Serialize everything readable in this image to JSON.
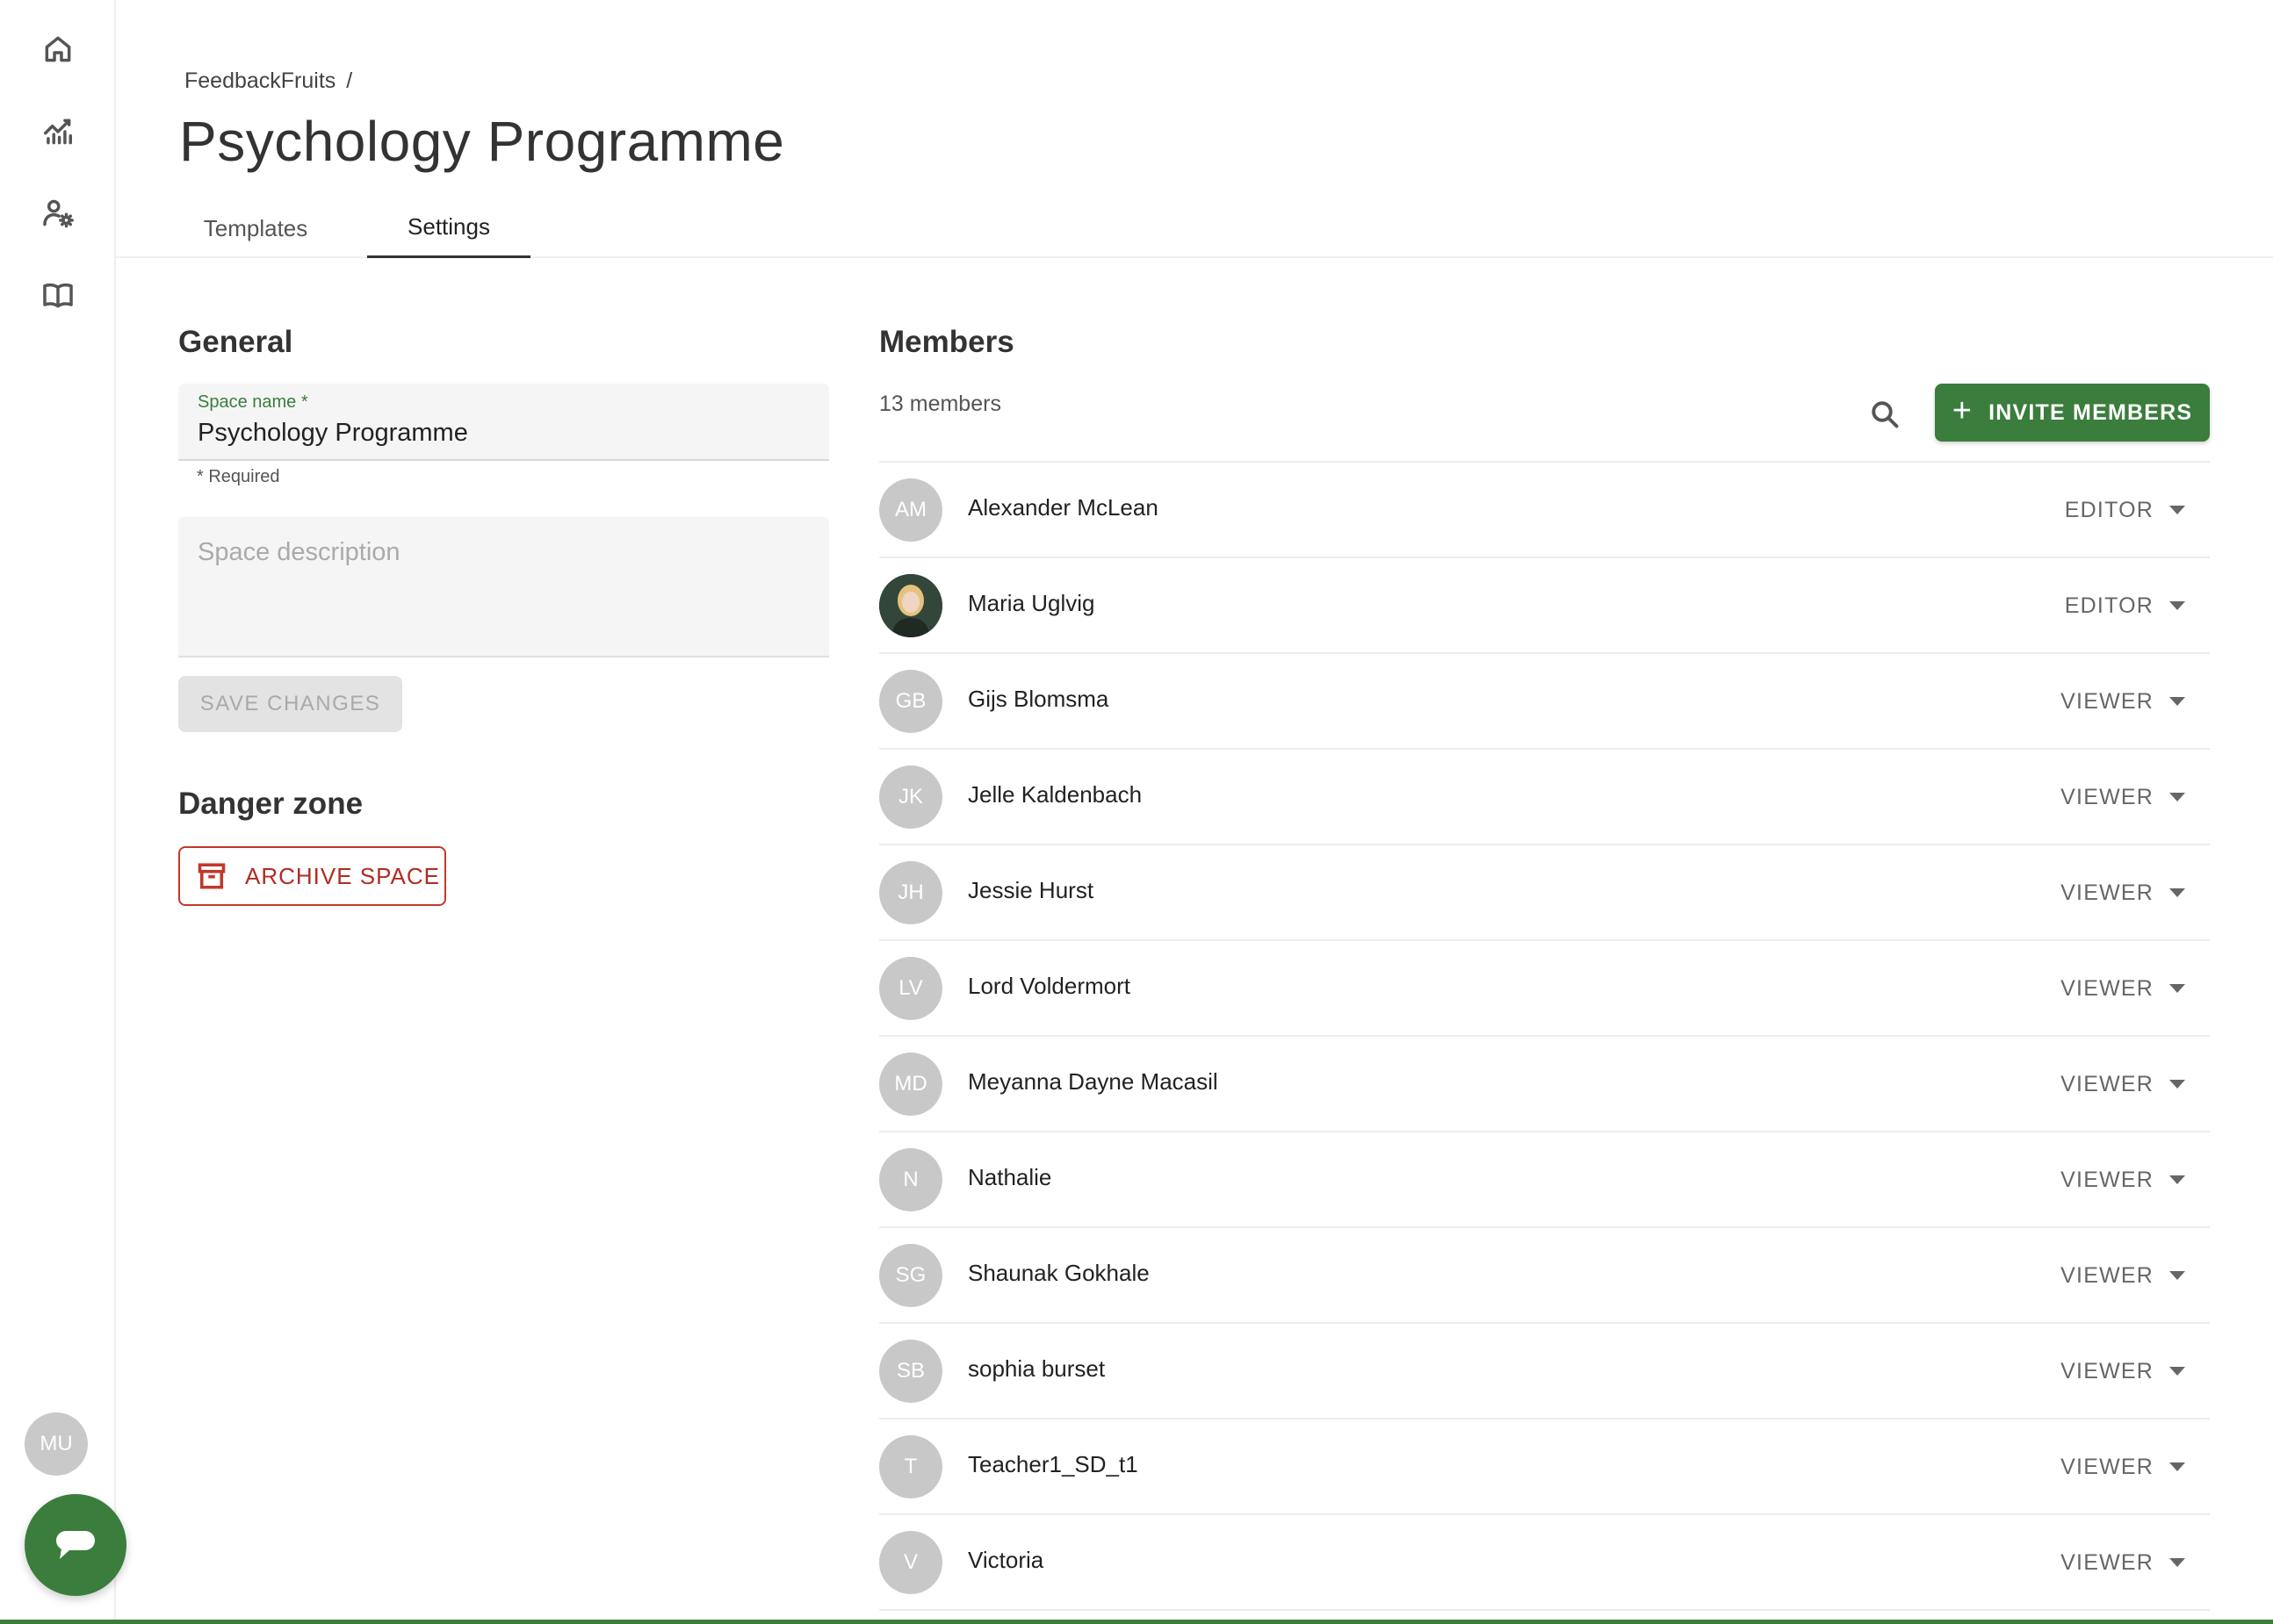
{
  "sidebar": {
    "items": [
      {
        "name": "home-icon"
      },
      {
        "name": "analytics-icon"
      },
      {
        "name": "user-settings-icon"
      },
      {
        "name": "book-icon"
      }
    ],
    "user_initials": "MU"
  },
  "header": {
    "breadcrumb": [
      "FeedbackFruits",
      "/"
    ],
    "title": "Psychology Programme",
    "tabs": [
      {
        "label": "Templates",
        "active": false
      },
      {
        "label": "Settings",
        "active": true
      }
    ]
  },
  "general": {
    "title": "General",
    "space_name_label": "Space name *",
    "space_name_value": "Psychology Programme",
    "required_hint": "* Required",
    "description_placeholder": "Space description",
    "save_label": "SAVE CHANGES"
  },
  "danger": {
    "title": "Danger zone",
    "archive_label": "ARCHIVE SPACE"
  },
  "members": {
    "title": "Members",
    "count_label": "13 members",
    "invite_label": "INVITE MEMBERS",
    "list": [
      {
        "initials": "AM",
        "name": "Alexander McLean",
        "role": "EDITOR",
        "photo": false
      },
      {
        "initials": "",
        "name": "Maria Uglvig",
        "role": "EDITOR",
        "photo": true
      },
      {
        "initials": "GB",
        "name": "Gijs Blomsma",
        "role": "VIEWER",
        "photo": false
      },
      {
        "initials": "JK",
        "name": "Jelle Kaldenbach",
        "role": "VIEWER",
        "photo": false
      },
      {
        "initials": "JH",
        "name": "Jessie Hurst",
        "role": "VIEWER",
        "photo": false
      },
      {
        "initials": "LV",
        "name": "Lord Voldermort",
        "role": "VIEWER",
        "photo": false
      },
      {
        "initials": "MD",
        "name": "Meyanna Dayne Macasil",
        "role": "VIEWER",
        "photo": false
      },
      {
        "initials": "N",
        "name": "Nathalie",
        "role": "VIEWER",
        "photo": false
      },
      {
        "initials": "SG",
        "name": "Shaunak Gokhale",
        "role": "VIEWER",
        "photo": false
      },
      {
        "initials": "SB",
        "name": "sophia burset",
        "role": "VIEWER",
        "photo": false
      },
      {
        "initials": "T",
        "name": "Teacher1_SD_t1",
        "role": "VIEWER",
        "photo": false
      },
      {
        "initials": "V",
        "name": "Victoria",
        "role": "VIEWER",
        "photo": false
      }
    ]
  },
  "colors": {
    "accent": "#3a7d3c",
    "danger": "#c0392b",
    "avatar_gray": "#c8c8c8"
  }
}
